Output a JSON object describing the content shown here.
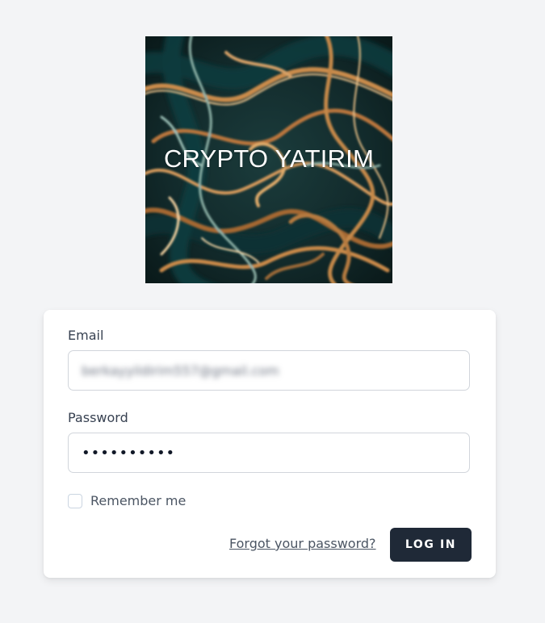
{
  "logo": {
    "text": "CRYPTO YATIRIM"
  },
  "form": {
    "email": {
      "label": "Email",
      "value": "berkayyildirim557@gmail.com"
    },
    "password": {
      "label": "Password",
      "value": "••••••••••"
    },
    "remember": {
      "label": "Remember me",
      "checked": false
    },
    "forgot_link": "Forgot your password?",
    "login_button": "LOG IN"
  },
  "colors": {
    "background": "#f3f4f6",
    "button": "#1f2937",
    "card": "#ffffff"
  }
}
